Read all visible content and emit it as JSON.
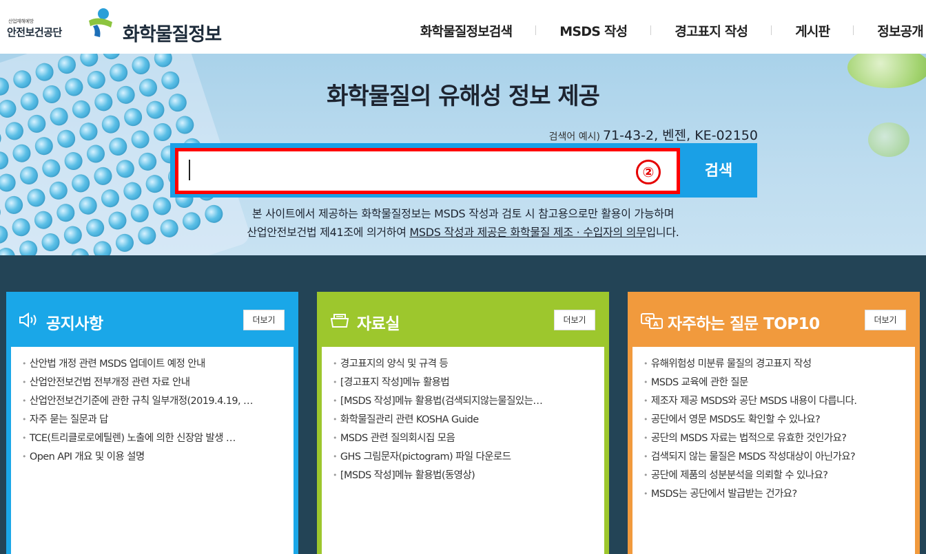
{
  "header": {
    "org_small": "산업재해예방",
    "org_name": "안전보건공단",
    "site_title": "화학물질정보",
    "nav": [
      "화학물질정보검색",
      "MSDS 작성",
      "경고표지 작성",
      "게시판",
      "정보공개"
    ]
  },
  "hero": {
    "title": "화학물질의 유해성 정보 제공",
    "example_label": "검색어 예시)",
    "example_value": "71-43-2, 벤젠, KE-02150",
    "search_value": "",
    "marker": "②",
    "search_button": "검색",
    "notice_line1": "본 사이트에서 제공하는 화학물질정보는 MSDS 작성과 검토 시 참고용으로만 활용이 가능하며",
    "notice_line2_prefix": "산업안전보건법 제41조에 의거하여 ",
    "notice_line2_underlined": "MSDS 작성과 제공은 화학물질 제조 · 수입자의 의무",
    "notice_line2_suffix": "입니다."
  },
  "panels": [
    {
      "title": "공지사항",
      "icon": "speaker-icon",
      "more": "더보기",
      "color": "#1aa7e8",
      "items": [
        "산안법 개정 관련 MSDS 업데이트 예정 안내",
        "산업안전보건법 전부개정 관련 자료 안내",
        "산업안전보건기준에 관한 규칙 일부개정(2019.4.19, …",
        "자주 묻는 질문과 답",
        "TCE(트리클로로에틸렌) 노출에 의한 신장암 발생 …",
        "Open API 개요 및 이용 설명"
      ]
    },
    {
      "title": "자료실",
      "icon": "folder-icon",
      "more": "더보기",
      "color": "#9dc72d",
      "items": [
        "경고표지의 양식 및 규격 등",
        "[경고표지 작성]메뉴 활용법",
        "[MSDS 작성]메뉴 활용법(검색되지않는물질있는…",
        "화학물질관리 관련 KOSHA Guide",
        "MSDS 관련 질의회시집 모음",
        "GHS 그림문자(pictogram) 파일 다운로드",
        "[MSDS 작성]메뉴 활용법(동영상)"
      ]
    },
    {
      "title": "자주하는 질문 TOP10",
      "icon": "qa-icon",
      "more": "더보기",
      "color": "#f19a3d",
      "items": [
        "유해위험성 미분류 물질의 경고표지 작성",
        "MSDS 교육에 관한 질문",
        "제조자 제공 MSDS와 공단 MSDS 내용이 다릅니다.",
        "공단에서 영문 MSDS도 확인할 수 있나요?",
        "공단의 MSDS 자료는 법적으로 유효한 것인가요?",
        "검색되지 않는 물질은 MSDS 작성대상이 아닌가요?",
        "공단에 제품의 성분분석을 의뢰할 수 있나요?",
        "MSDS는 공단에서 발급받는 건가요?"
      ]
    }
  ]
}
